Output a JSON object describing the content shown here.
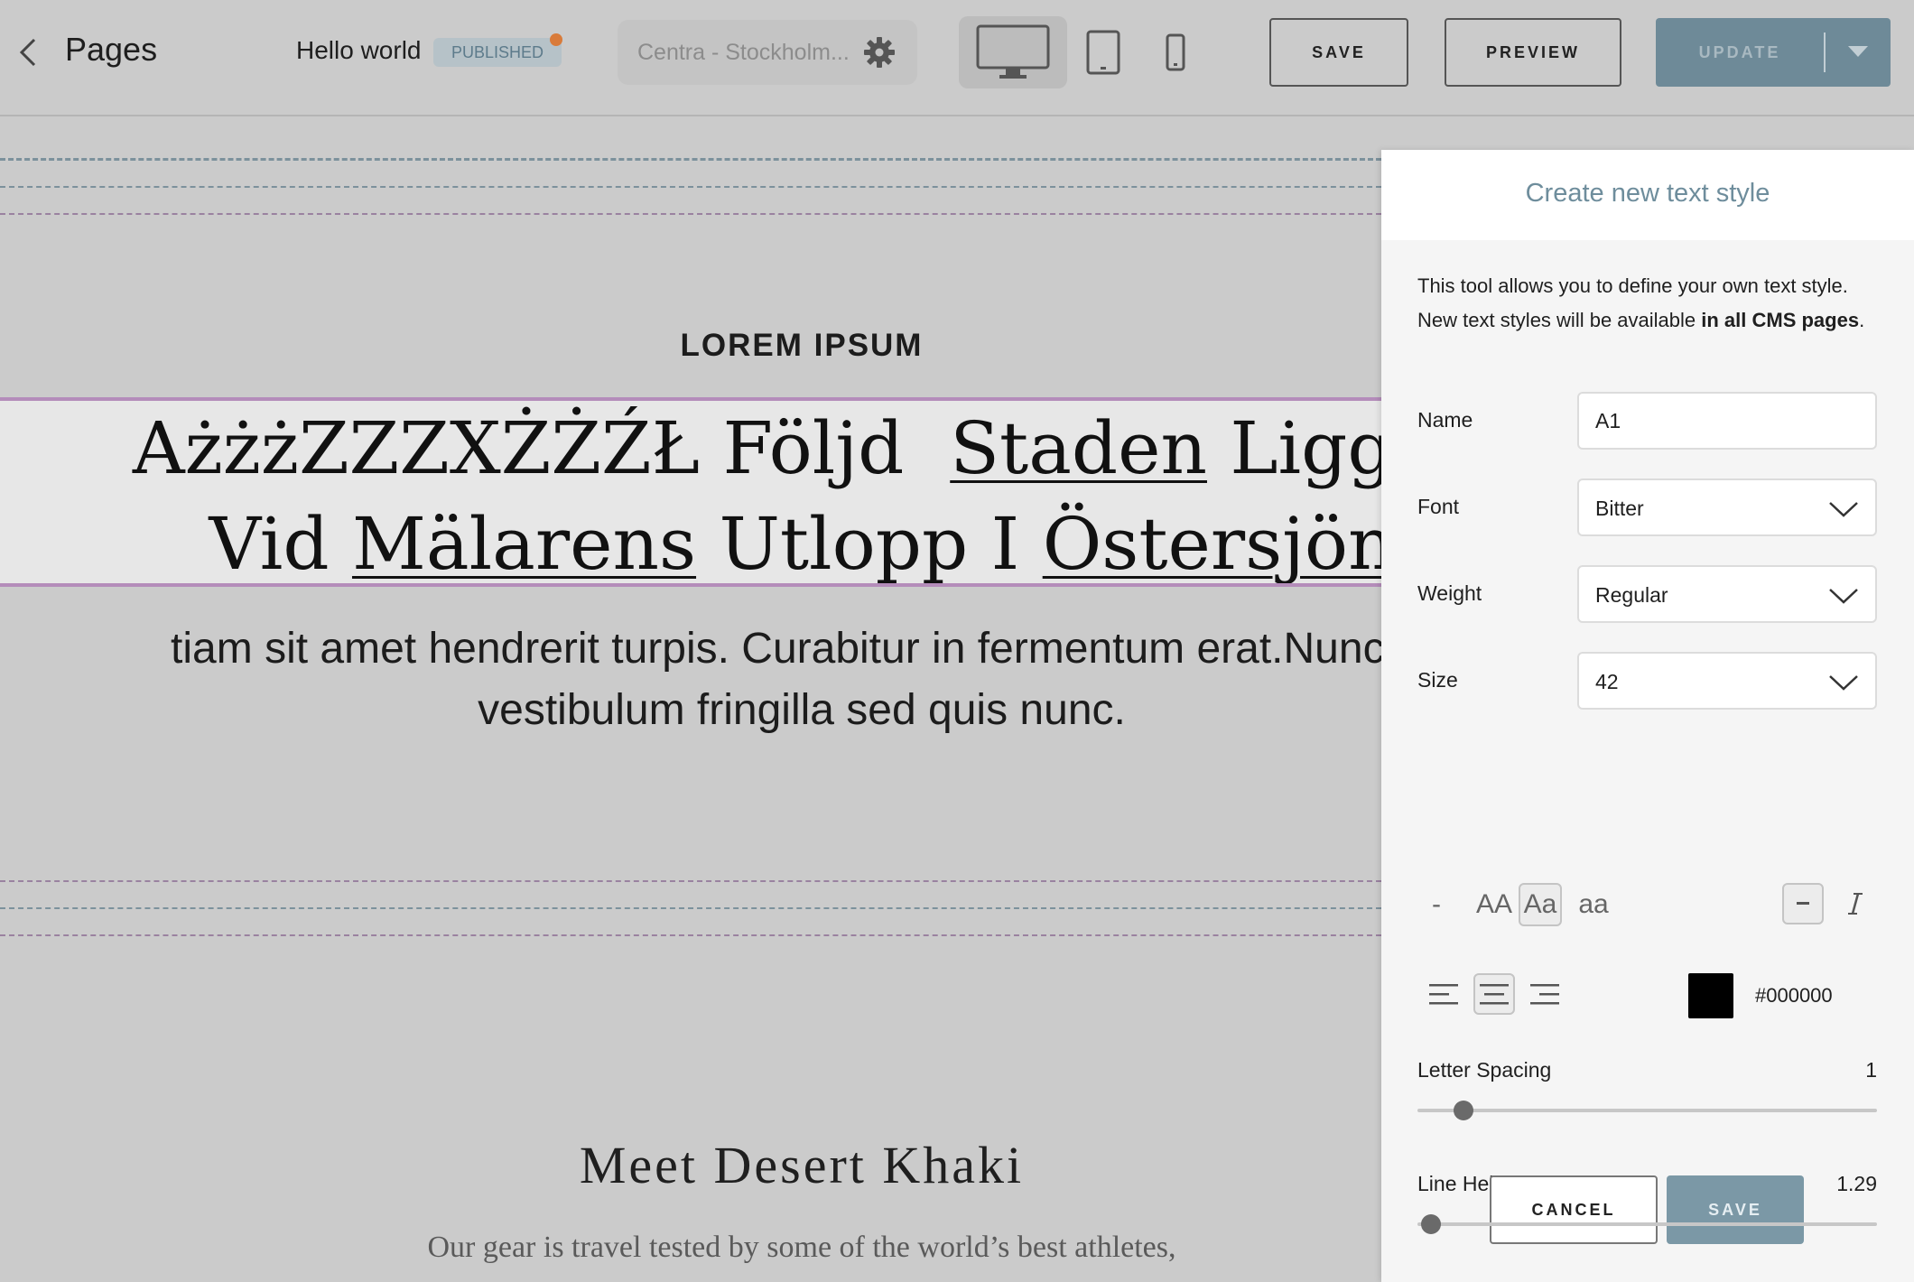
{
  "topbar": {
    "back_icon": "chevron-left-icon",
    "title": "Pages",
    "page_name": "Hello world",
    "status": "PUBLISHED",
    "status_dot_color": "#d97b3a",
    "market": "Centra - Stockholm...",
    "settings_icon": "gear-icon",
    "devices": [
      "desktop-icon",
      "tablet-icon",
      "mobile-icon"
    ],
    "active_device": "desktop",
    "save_label": "SAVE",
    "preview_label": "PREVIEW",
    "update_label": "UPDATE",
    "accent_color": "#6e8a98"
  },
  "canvas": {
    "eyebrow": "LOREM IPSUM",
    "headline": {
      "line1": [
        {
          "text": "AżżżZZZXŻŻŹŁ Följd  ",
          "underline": false
        },
        {
          "text": "Staden",
          "underline": true
        },
        {
          "text": " Ligger",
          "underline": false
        }
      ],
      "line2": [
        {
          "text": "Vid ",
          "underline": false
        },
        {
          "text": "Mälarens",
          "underline": true
        },
        {
          "text": " Utlopp I ",
          "underline": false
        },
        {
          "text": "Östersjön",
          "underline": true
        }
      ]
    },
    "body_line1": "tiam sit amet hendrerit turpis. Curabitur in fermentum erat.Nunc et",
    "body_line2": "vestibulum fringilla sed quis nunc.",
    "section_title": "Meet Desert Khaki",
    "section_subtitle": "Our gear is travel tested by some of the world’s best athletes,"
  },
  "panel": {
    "title": "Create new text style",
    "description_prefix": "This tool allows you to define your own text style. New text styles will be available ",
    "description_bold": "in all CMS pages",
    "description_suffix": ".",
    "name_label": "Name",
    "name_value": "A1",
    "font_label": "Font",
    "font_value": "Bitter",
    "weight_label": "Weight",
    "weight_value": "Regular",
    "size_label": "Size",
    "size_value": "42",
    "case_options": [
      "-",
      "AA",
      "Aa",
      "aa"
    ],
    "case_selected": "Aa",
    "decoration_icon": "minus-icon",
    "italic_icon": "italic-icon",
    "alignment_icons": [
      "align-left-icon",
      "align-center-icon",
      "align-right-icon"
    ],
    "alignment_selected": "center",
    "color_value": "#000000",
    "letter_spacing_label": "Letter Spacing",
    "letter_spacing_value": "1",
    "letter_spacing_fraction": 0.1,
    "line_height_label": "Line Height",
    "line_height_value": "1.29",
    "line_height_fraction": 0.03,
    "cancel_label": "CANCEL",
    "save_label": "SAVE",
    "save_color": "#7b98a6"
  }
}
